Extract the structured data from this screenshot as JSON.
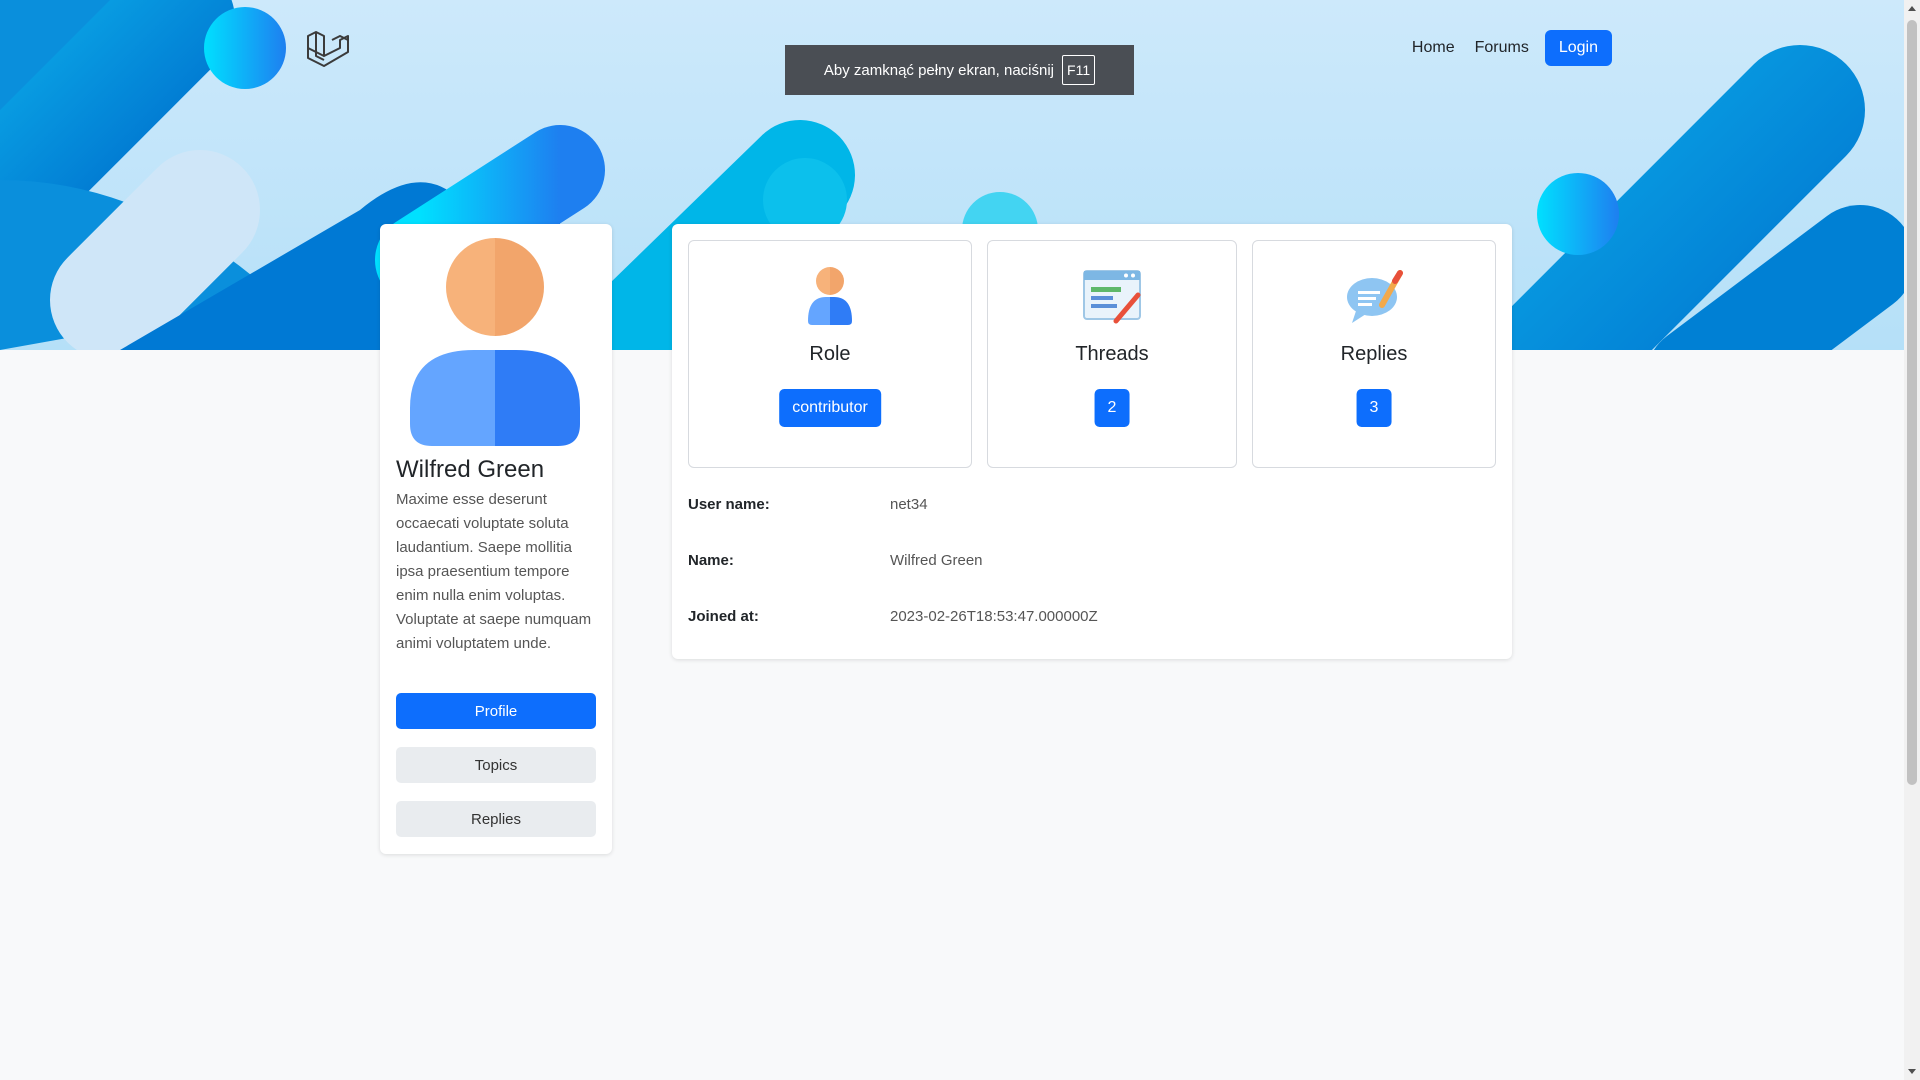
{
  "nav": {
    "home": "Home",
    "forums": "Forums",
    "login": "Login"
  },
  "fullscreen_notice": {
    "text": "Aby zamknąć pełny ekran, naciśnij",
    "key": "F11"
  },
  "profile": {
    "name": "Wilfred Green",
    "bio": "Maxime esse deserunt occaecati voluptate soluta laudantium. Saepe mollitia ipsa praesentium tempore enim nulla enim voluptas. Voluptate at saepe numquam animi voluptatem unde.",
    "buttons": {
      "profile": "Profile",
      "topics": "Topics",
      "replies": "Replies"
    }
  },
  "stats": {
    "role": {
      "label": "Role",
      "value": "contributor"
    },
    "threads": {
      "label": "Threads",
      "value": "2"
    },
    "replies": {
      "label": "Replies",
      "value": "3"
    }
  },
  "details": {
    "username_label": "User name:",
    "username_value": "net34",
    "name_label": "Name:",
    "name_value": "Wilfred Green",
    "joined_label": "Joined at:",
    "joined_value": "2023-02-26T18:53:47.000000Z"
  },
  "colors": {
    "primary": "#0d6efd",
    "hero_light": "#cde9fb",
    "hero_blue": "#0088d6",
    "hero_cyan": "#00c6f0"
  }
}
